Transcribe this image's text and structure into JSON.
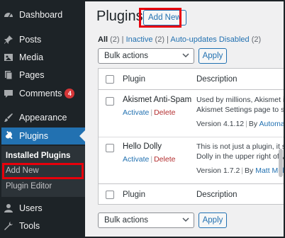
{
  "sidebar": {
    "items": [
      {
        "label": "Dashboard",
        "icon": "dashboard-icon"
      },
      {
        "label": "Posts",
        "icon": "pin-icon"
      },
      {
        "label": "Media",
        "icon": "media-icon"
      },
      {
        "label": "Pages",
        "icon": "pages-icon"
      },
      {
        "label": "Comments",
        "icon": "comment-icon",
        "badge": "4"
      },
      {
        "label": "Appearance",
        "icon": "brush-icon"
      },
      {
        "label": "Plugins",
        "icon": "plug-icon"
      },
      {
        "label": "Users",
        "icon": "user-icon"
      },
      {
        "label": "Tools",
        "icon": "wrench-icon"
      }
    ],
    "submenu": [
      {
        "label": "Installed Plugins"
      },
      {
        "label": "Add New"
      },
      {
        "label": "Plugin Editor"
      }
    ]
  },
  "header": {
    "title": "Plugins",
    "add_new": "Add New"
  },
  "views": {
    "all": "All",
    "all_count": "(2)",
    "inactive": "Inactive",
    "inactive_count": "(2)",
    "autoupdates": "Auto-updates Disabled",
    "autoupdates_count": "(2)",
    "separator": "|"
  },
  "bulk": {
    "selected": "Bulk actions",
    "apply": "Apply"
  },
  "table": {
    "col_plugin": "Plugin",
    "col_description": "Description",
    "rows": [
      {
        "name": "Akismet Anti-Spam",
        "activate": "Activate",
        "delete": "Delete",
        "desc_line1": "Used by millions, Akismet is",
        "desc_line2": "Akismet Settings page to se",
        "version": "Version 4.1.12",
        "by": "By",
        "author": "Automattic"
      },
      {
        "name": "Hello Dolly",
        "activate": "Activate",
        "delete": "Delete",
        "desc_line1": "This is not just a plugin, it sy",
        "desc_line2": "Dolly in the upper right of yo",
        "version": "Version 1.7.2",
        "by": "By",
        "author": "Matt Mulle"
      }
    ]
  },
  "colors": {
    "sidebar_bg": "#1d2327",
    "accent": "#2271b1",
    "highlight": "#e8000b",
    "badge": "#d63638"
  }
}
